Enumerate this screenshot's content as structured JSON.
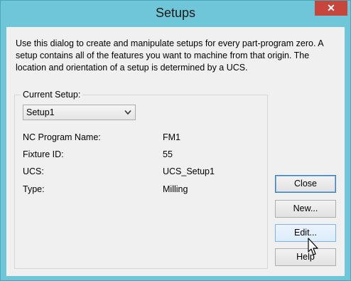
{
  "window": {
    "title": "Setups",
    "close_glyph": "✕"
  },
  "intro": "Use this dialog to create and manipulate setups for every part-program zero. A setup contains all of the features you want to machine from that origin. The location and orientation of a setup is determined by a UCS.",
  "current_setup": {
    "legend": "Current Setup:",
    "selected": "Setup1"
  },
  "fields": [
    {
      "label": "NC Program Name:",
      "value": "FM1"
    },
    {
      "label": "Fixture ID:",
      "value": "55"
    },
    {
      "label": "UCS:",
      "value": "UCS_Setup1"
    },
    {
      "label": "Type:",
      "value": "Milling"
    }
  ],
  "buttons": {
    "close": "Close",
    "new": "New...",
    "edit": "Edit...",
    "help": "Help"
  },
  "icons": {
    "dropdown": "chevron-down-icon",
    "cursor": "pointer-cursor-icon"
  }
}
